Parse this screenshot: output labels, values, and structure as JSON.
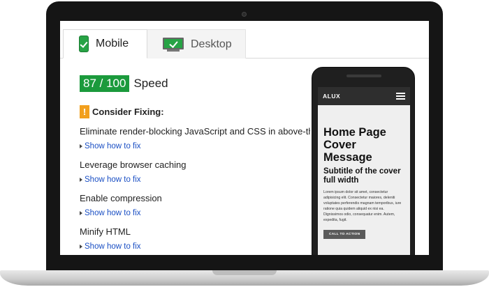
{
  "tabs": [
    {
      "label": "Mobile",
      "active": true
    },
    {
      "label": "Desktop",
      "active": false
    }
  ],
  "score": {
    "value": "87 / 100",
    "label": "Speed",
    "color": "#1b9a3c"
  },
  "consider": {
    "label": "Consider Fixing:",
    "icon": "!"
  },
  "rules": [
    {
      "title": "Eliminate render-blocking JavaScript and CSS in above-the-fold content",
      "link": "Show how to fix"
    },
    {
      "title": "Leverage browser caching",
      "link": "Show how to fix"
    },
    {
      "title": "Enable compression",
      "link": "Show how to fix"
    },
    {
      "title": "Minify HTML",
      "link": "Show how to fix"
    }
  ],
  "phone_preview": {
    "brand": "ALUX",
    "hero_title": "Home Page Cover Message",
    "hero_subtitle": "Subtitle of the cover full width",
    "hero_body": "Lorem ipsum dolor sit amet, consectetur adipisicing elit. Consectetur maiores, deleniti voluptates perferendis magnam temporibus, iure ratione quia quidem aliquid ex nisi ea. Dignissimos odio, consequatur enim. Autem, expedita, fugit.",
    "cta": "CALL TO ACTION"
  },
  "colors": {
    "accent_green": "#27a345",
    "warning": "#f2a01e",
    "link": "#1a4fc4"
  }
}
